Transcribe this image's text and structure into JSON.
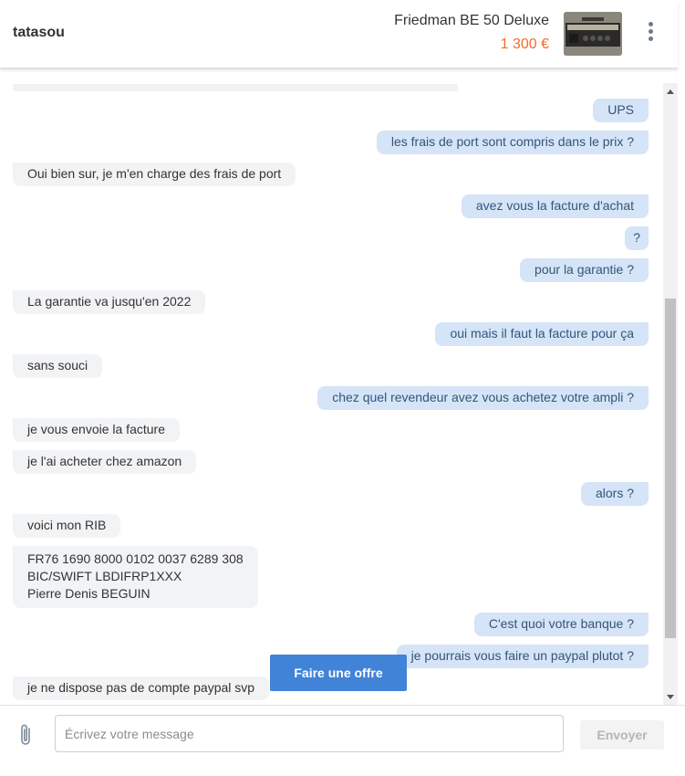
{
  "header": {
    "username": "tatasou",
    "product_title": "Friedman BE 50 Deluxe",
    "product_price": "1 300 €",
    "more_icon": "more-vertical-icon"
  },
  "messages": [
    {
      "side": "sent",
      "text": "UPS"
    },
    {
      "side": "sent",
      "text": "les frais de port sont compris dans le prix ?"
    },
    {
      "side": "recv",
      "text": "Oui bien sur, je m'en charge des frais de port"
    },
    {
      "side": "sent",
      "text": "avez vous la facture d'achat"
    },
    {
      "side": "sent",
      "text": "?"
    },
    {
      "side": "sent",
      "text": "pour la garantie ?"
    },
    {
      "side": "recv",
      "text": "La garantie va jusqu'en 2022"
    },
    {
      "side": "sent",
      "text": "oui mais il faut la facture pour ça"
    },
    {
      "side": "recv",
      "text": "sans souci"
    },
    {
      "side": "sent",
      "text": "chez quel revendeur avez vous achetez votre ampli ?"
    },
    {
      "side": "recv",
      "text": "je vous envoie la facture"
    },
    {
      "side": "recv",
      "text": "je l'ai acheter chez amazon"
    },
    {
      "side": "sent",
      "text": "alors ?"
    },
    {
      "side": "recv",
      "text": "voici mon RIB"
    },
    {
      "side": "recv",
      "text": "FR76 1690 8000 0102 0037 6289 308\nBIC/SWIFT LBDIFRP1XXX\nPierre Denis BEGUIN"
    },
    {
      "side": "sent",
      "text": "C'est quoi votre banque ?"
    },
    {
      "side": "sent",
      "text": "je pourrais vous faire un paypal plutot ?"
    },
    {
      "side": "recv",
      "text": "je ne dispose pas de compte paypal svp"
    }
  ],
  "offer_button": "Faire une offre",
  "composer": {
    "placeholder": "Écrivez votre message",
    "send_label": "Envoyer",
    "attach_icon": "paperclip-icon"
  },
  "colors": {
    "price": "#f56b2a",
    "sent_bubble": "#d5e4f7",
    "recv_bubble": "#f2f3f5",
    "primary_button": "#4183d7"
  }
}
